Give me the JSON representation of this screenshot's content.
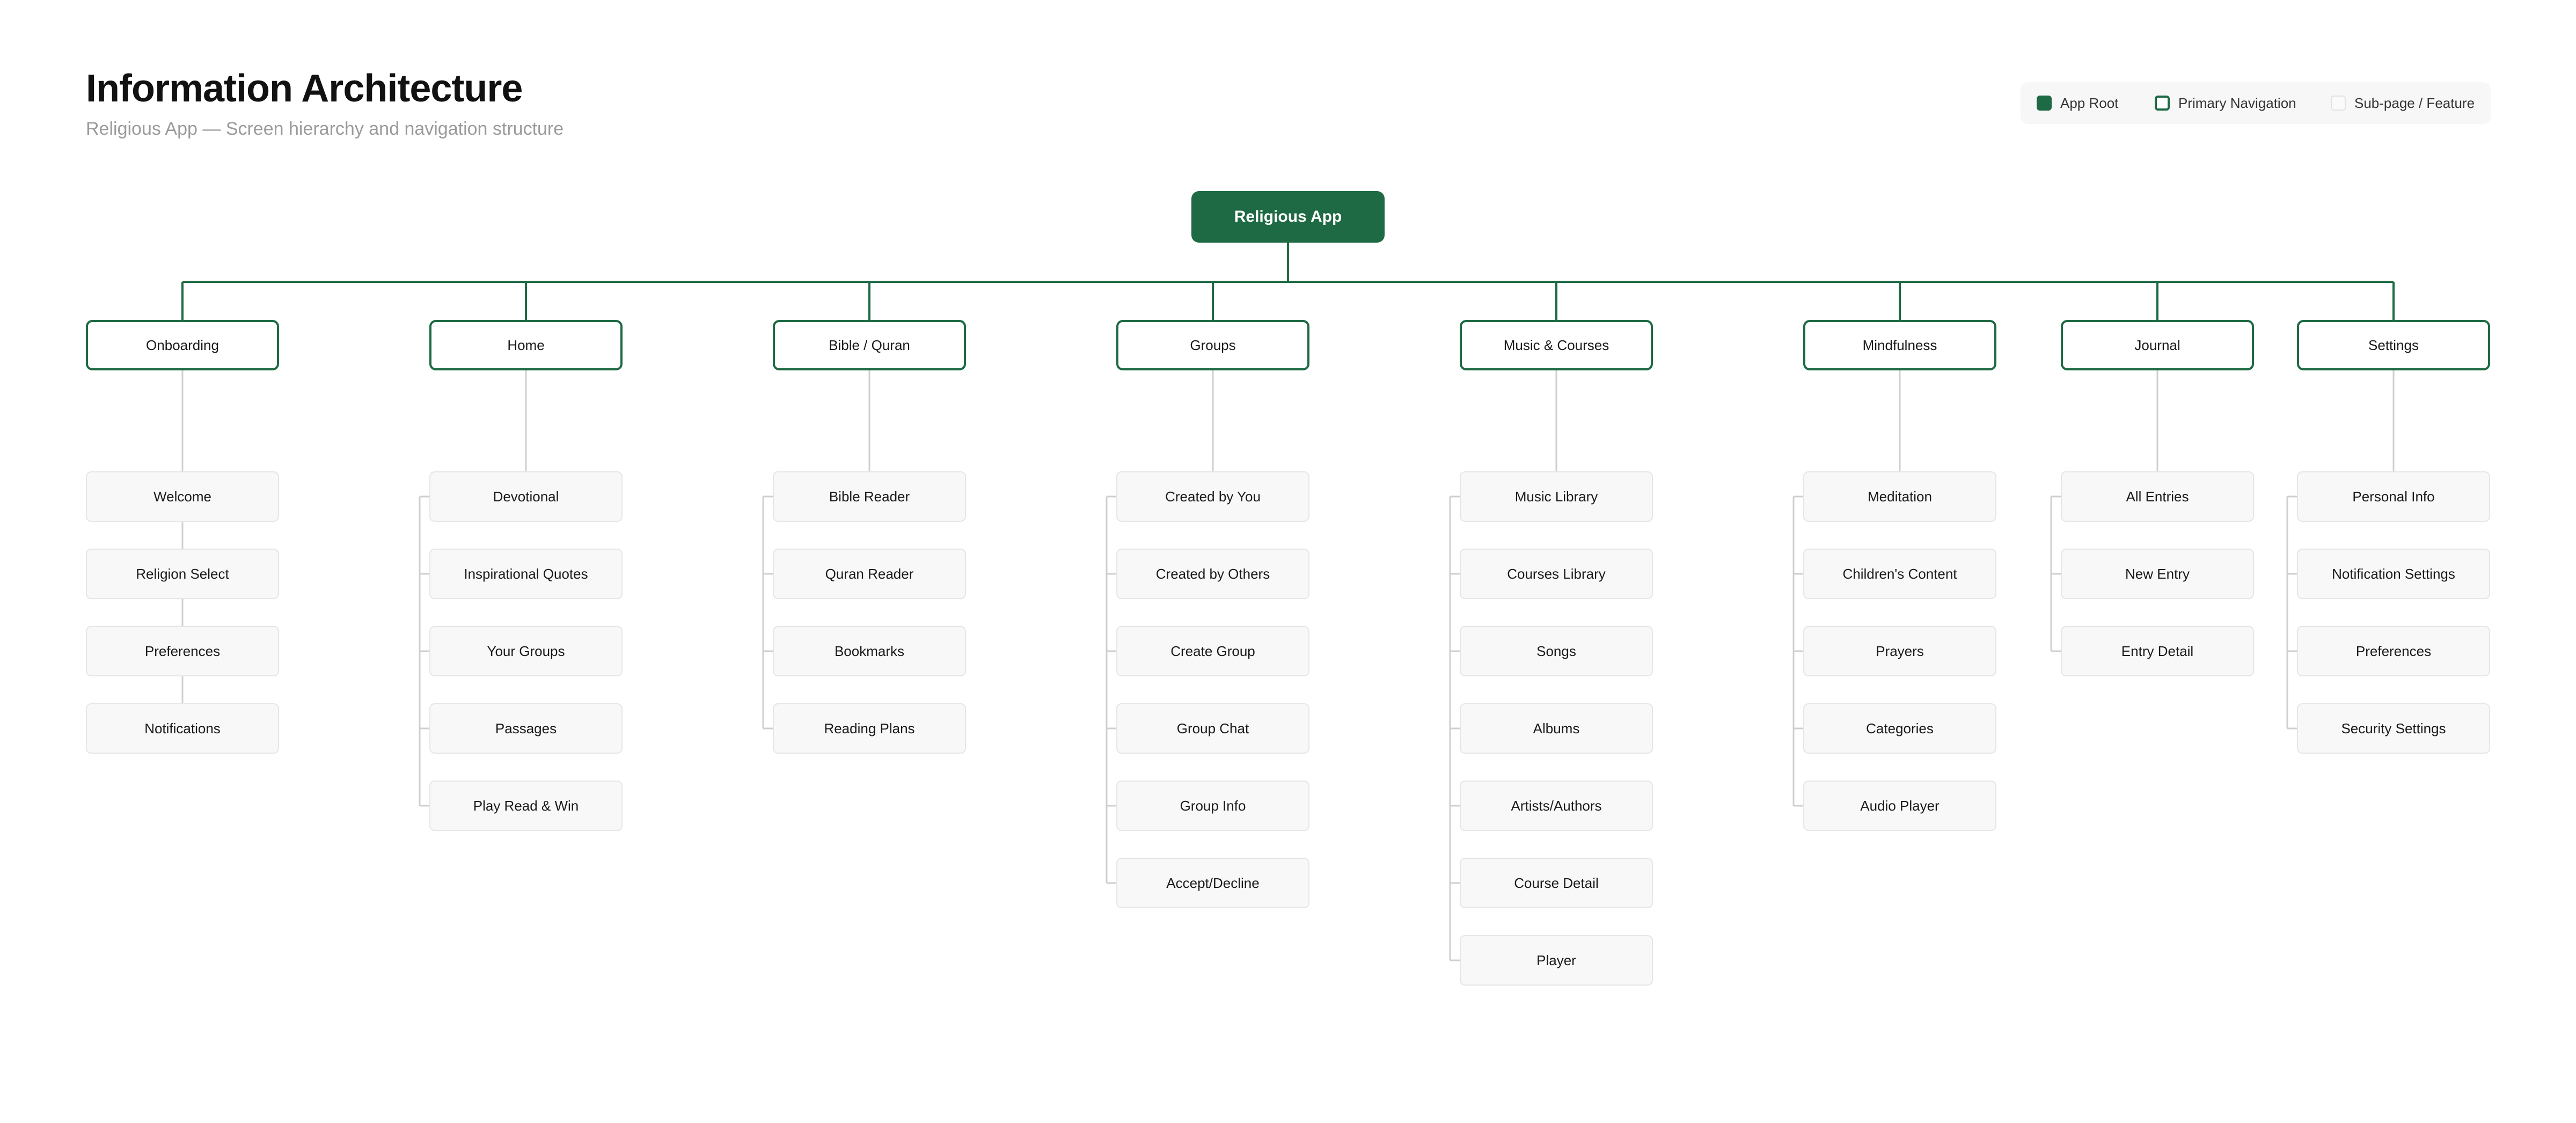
{
  "header": {
    "title": "Information Architecture",
    "subtitle": "Religious App — Screen hierarchy and navigation structure"
  },
  "legend": {
    "items": [
      {
        "label": "App Root",
        "kind": "root"
      },
      {
        "label": "Primary Navigation",
        "kind": "primary"
      },
      {
        "label": "Sub-page / Feature",
        "kind": "sub"
      }
    ]
  },
  "colors": {
    "brand_green": "#1e6a44",
    "sub_fill": "#f8f8f8",
    "sub_border": "#e6e6e6",
    "connector_gray": "#cfcfcf"
  },
  "tree": {
    "root": "Religious App",
    "branches": [
      {
        "label": "Onboarding",
        "children": [
          "Welcome",
          "Religion Select",
          "Preferences",
          "Notifications"
        ]
      },
      {
        "label": "Home",
        "children": [
          "Devotional",
          "Inspirational Quotes",
          "Your Groups",
          "Passages",
          "Play Read & Win"
        ]
      },
      {
        "label": "Bible / Quran",
        "children": [
          "Bible Reader",
          "Quran Reader",
          "Bookmarks",
          "Reading Plans"
        ]
      },
      {
        "label": "Groups",
        "children": [
          "Created by You",
          "Created by Others",
          "Create Group",
          "Group Chat",
          "Group Info",
          "Accept/Decline"
        ]
      },
      {
        "label": "Music & Courses",
        "children": [
          "Music Library",
          "Courses Library",
          "Songs",
          "Albums",
          "Artists/Authors",
          "Course Detail",
          "Player"
        ]
      },
      {
        "label": "Mindfulness",
        "children": [
          "Meditation",
          "Children's Content",
          "Prayers",
          "Categories",
          "Audio Player"
        ]
      },
      {
        "label": "Journal",
        "children": [
          "All Entries",
          "New Entry",
          "Entry Detail"
        ]
      },
      {
        "label": "Settings",
        "children": [
          "Personal Info",
          "Notification Settings",
          "Preferences",
          "Security Settings"
        ]
      }
    ]
  }
}
